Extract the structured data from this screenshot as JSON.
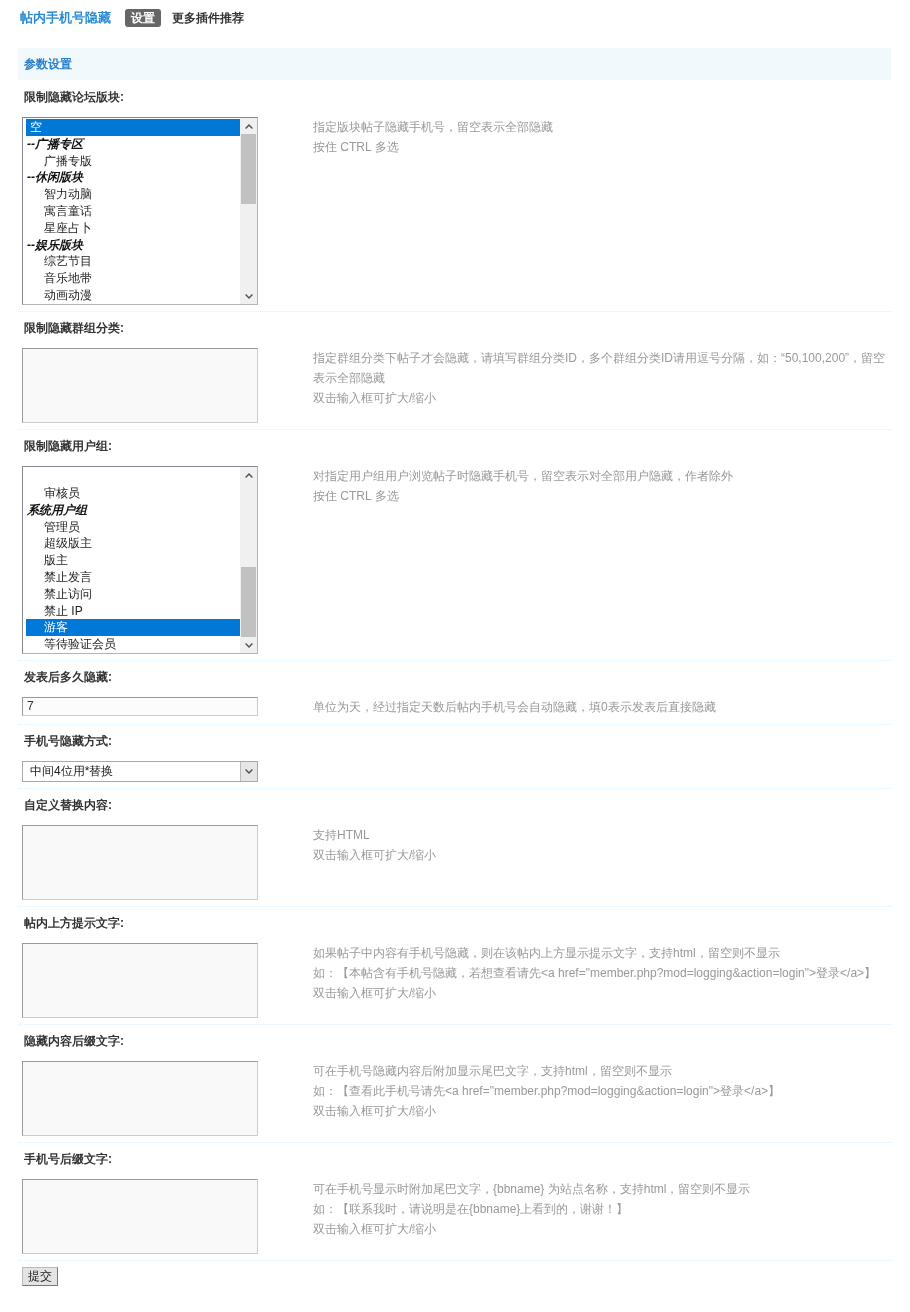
{
  "header": {
    "title": "帖内手机号隐藏",
    "tabs": [
      {
        "label": "设置",
        "selected": true
      },
      {
        "label": "更多插件推荐",
        "selected": false
      }
    ]
  },
  "section": {
    "title": "参数设置"
  },
  "settings": [
    {
      "label": "限制隐藏论坛版块:",
      "field": {
        "kind": "multiselect",
        "items": [
          {
            "kind": "option",
            "label": "空",
            "selected": true
          },
          {
            "kind": "group",
            "label": "--广播专区",
            "children": [
              {
                "label": "广播专版",
                "selected": false
              }
            ]
          },
          {
            "kind": "group",
            "label": "--休闲版块",
            "children": [
              {
                "label": "智力动脑",
                "selected": false
              },
              {
                "label": "寓言童话",
                "selected": false
              },
              {
                "label": "星座占卜",
                "selected": false
              }
            ]
          },
          {
            "kind": "group",
            "label": "--娱乐版块",
            "children": [
              {
                "label": "综艺节目",
                "selected": false
              },
              {
                "label": "音乐地带",
                "selected": false
              },
              {
                "label": "动画动漫",
                "selected": false
              }
            ]
          }
        ]
      },
      "help": [
        "指定版块帖子隐藏手机号，留空表示全部隐藏",
        "按住 CTRL 多选"
      ]
    },
    {
      "label": "限制隐藏群组分类:",
      "field": {
        "kind": "textarea"
      },
      "help": [
        "指定群组分类下帖子才会隐藏，请填写群组分类ID，多个群组分类ID请用逗号分隔，如：“50,100,200”，留空表示全部隐藏",
        "双击输入框可扩大/缩小"
      ]
    },
    {
      "label": "限制隐藏用户组:",
      "field": {
        "kind": "multiselect",
        "items": [
          {
            "kind": "group",
            "children": [
              {
                "label": "审核员",
                "selected": false
              }
            ]
          },
          {
            "kind": "group",
            "label": "系统用户组",
            "children": [
              {
                "label": "管理员",
                "selected": false
              },
              {
                "label": "超级版主",
                "selected": false
              },
              {
                "label": "版主",
                "selected": false
              },
              {
                "label": "禁止发言",
                "selected": false
              },
              {
                "label": "禁止访问",
                "selected": false
              },
              {
                "label": "禁止 IP",
                "selected": false
              },
              {
                "label": "游客",
                "selected": true
              },
              {
                "label": "等待验证会员",
                "selected": false
              }
            ]
          }
        ]
      },
      "help": [
        "对指定用户组用户浏览帖子时隐藏手机号，留空表示对全部用户隐藏，作者除外",
        "按住 CTRL 多选"
      ]
    },
    {
      "label": "发表后多久隐藏:",
      "field": {
        "kind": "text",
        "value": "7"
      },
      "help": [
        "单位为天，经过指定天数后帖内手机号会自动隐藏，填0表示发表后直接隐藏"
      ]
    },
    {
      "label": "手机号隐藏方式:",
      "field": {
        "kind": "dropdown",
        "value": "中间4位用*替换"
      }
    },
    {
      "label": "自定义替换内容:",
      "field": {
        "kind": "textarea"
      },
      "help": [
        "支持HTML",
        "双击输入框可扩大/缩小"
      ]
    },
    {
      "label": "帖内上方提示文字:",
      "field": {
        "kind": "textarea"
      },
      "help": [
        "如果帖子中内容有手机号隐藏，则在该帖内上方显示提示文字，支持html，留空则不显示",
        "如：【本帖含有手机号隐藏，若想查看请先<a href=\"member.php?mod=logging&action=login\">登录</a>】",
        "双击输入框可扩大/缩小"
      ]
    },
    {
      "label": "隐藏内容后缀文字:",
      "field": {
        "kind": "textarea"
      },
      "help": [
        "可在手机号隐藏内容后附加显示尾巴文字，支持html，留空则不显示",
        "如：【查看此手机号请先<a href=\"member.php?mod=logging&action=login\">登录</a>】",
        "双击输入框可扩大/缩小"
      ]
    },
    {
      "label": "手机号后缀文字:",
      "field": {
        "kind": "textarea"
      },
      "help": [
        "可在手机号显示时附加尾巴文字，{bbname} 为站点名称，支持html，留空则不显示",
        "如：【联系我时，请说明是在{bbname}上看到的，谢谢！】",
        "双击输入框可扩大/缩小"
      ]
    }
  ],
  "submit": {
    "label": "提交"
  }
}
